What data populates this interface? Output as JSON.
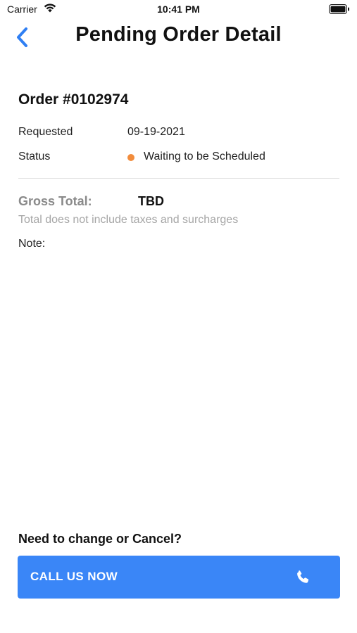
{
  "status_bar": {
    "carrier": "Carrier",
    "time": "10:41 PM",
    "icons": [
      "wifi-icon",
      "battery-icon"
    ]
  },
  "nav": {
    "back_icon": "chevron-left-icon",
    "title": "Pending Order Detail"
  },
  "order": {
    "number": "Order #0102974",
    "requested_label": "Requested",
    "requested_value": "09-19-2021",
    "status_label": "Status",
    "status_value": "Waiting to be Scheduled",
    "status_color": "#f28c3c"
  },
  "totals": {
    "gross_label": "Gross Total:",
    "gross_value": "TBD",
    "note_text": "Total does not include taxes and surcharges",
    "note_label": "Note:"
  },
  "contact": {
    "heading": "Need to change or Cancel?",
    "button_label": "CALL US NOW",
    "button_icon": "phone-icon",
    "button_color": "#3a86f7"
  },
  "colors": {
    "accent": "#2f7ff3",
    "muted": "#8a8a8a"
  }
}
